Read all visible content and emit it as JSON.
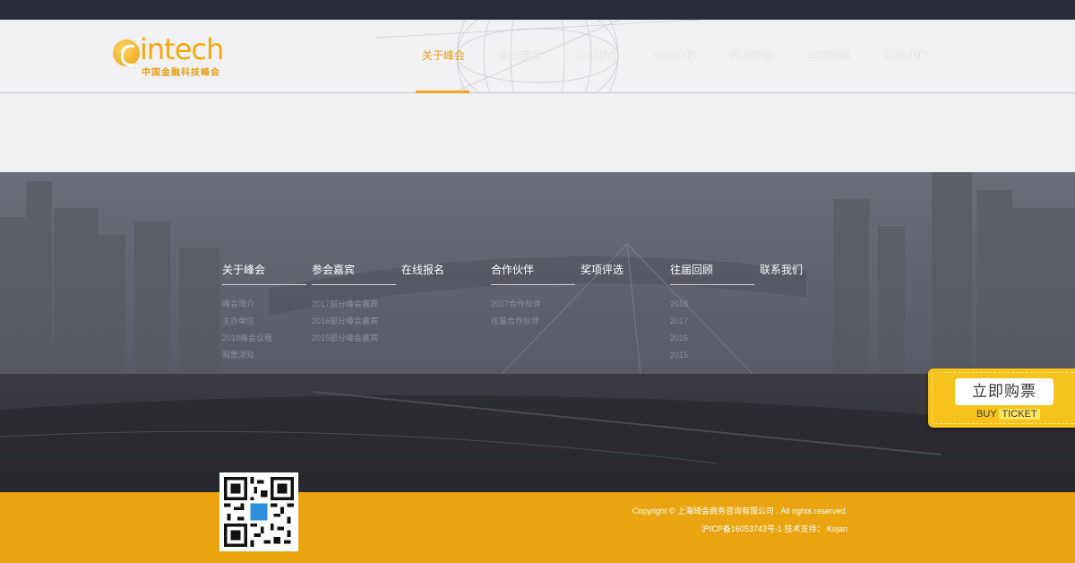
{
  "brand": {
    "logo_text": "intech",
    "logo_subtitle": "中国金融科技峰会"
  },
  "nav": {
    "items": [
      {
        "label": "关于峰会",
        "active": true
      },
      {
        "label": "参会嘉宾",
        "active": false
      },
      {
        "label": "在线报名",
        "active": false
      },
      {
        "label": "合作伙伴",
        "active": false
      },
      {
        "label": "奖项评选",
        "active": false
      },
      {
        "label": "往届回顾",
        "active": false
      },
      {
        "label": "联系我们",
        "active": false
      }
    ]
  },
  "footer": {
    "columns": [
      {
        "title": "关于峰会",
        "links": [
          "峰会简介",
          "主办单位",
          "2018峰会议程",
          "购票须知"
        ]
      },
      {
        "title": "参会嘉宾",
        "links": [
          "2017部分峰会嘉宾",
          "2016部分峰会嘉宾",
          "2015部分峰会嘉宾"
        ]
      },
      {
        "title": "在线报名",
        "links": []
      },
      {
        "title": "合作伙伴",
        "links": [
          "2017合作伙伴",
          "往届合作伙伴"
        ]
      },
      {
        "title": "奖项评选",
        "links": []
      },
      {
        "title": "往届回顾",
        "links": [
          "2018",
          "2017",
          "2016",
          "2015"
        ]
      },
      {
        "title": "联系我们",
        "links": []
      }
    ],
    "copyright": "Copyright © 上海琦会商务咨询有限公司 . All rights reserved.",
    "icp": "沪ICP备16053743号-1 技术支持： Kejan"
  },
  "ticket": {
    "label_cn": "立即购票",
    "label_buy": "BUY",
    "label_ticket": "TICKET"
  },
  "colors": {
    "accent": "#f0a418",
    "footer_bar": "#eaa410",
    "top_bar": "#2a2c3a",
    "footer_dark": "#62646f"
  }
}
